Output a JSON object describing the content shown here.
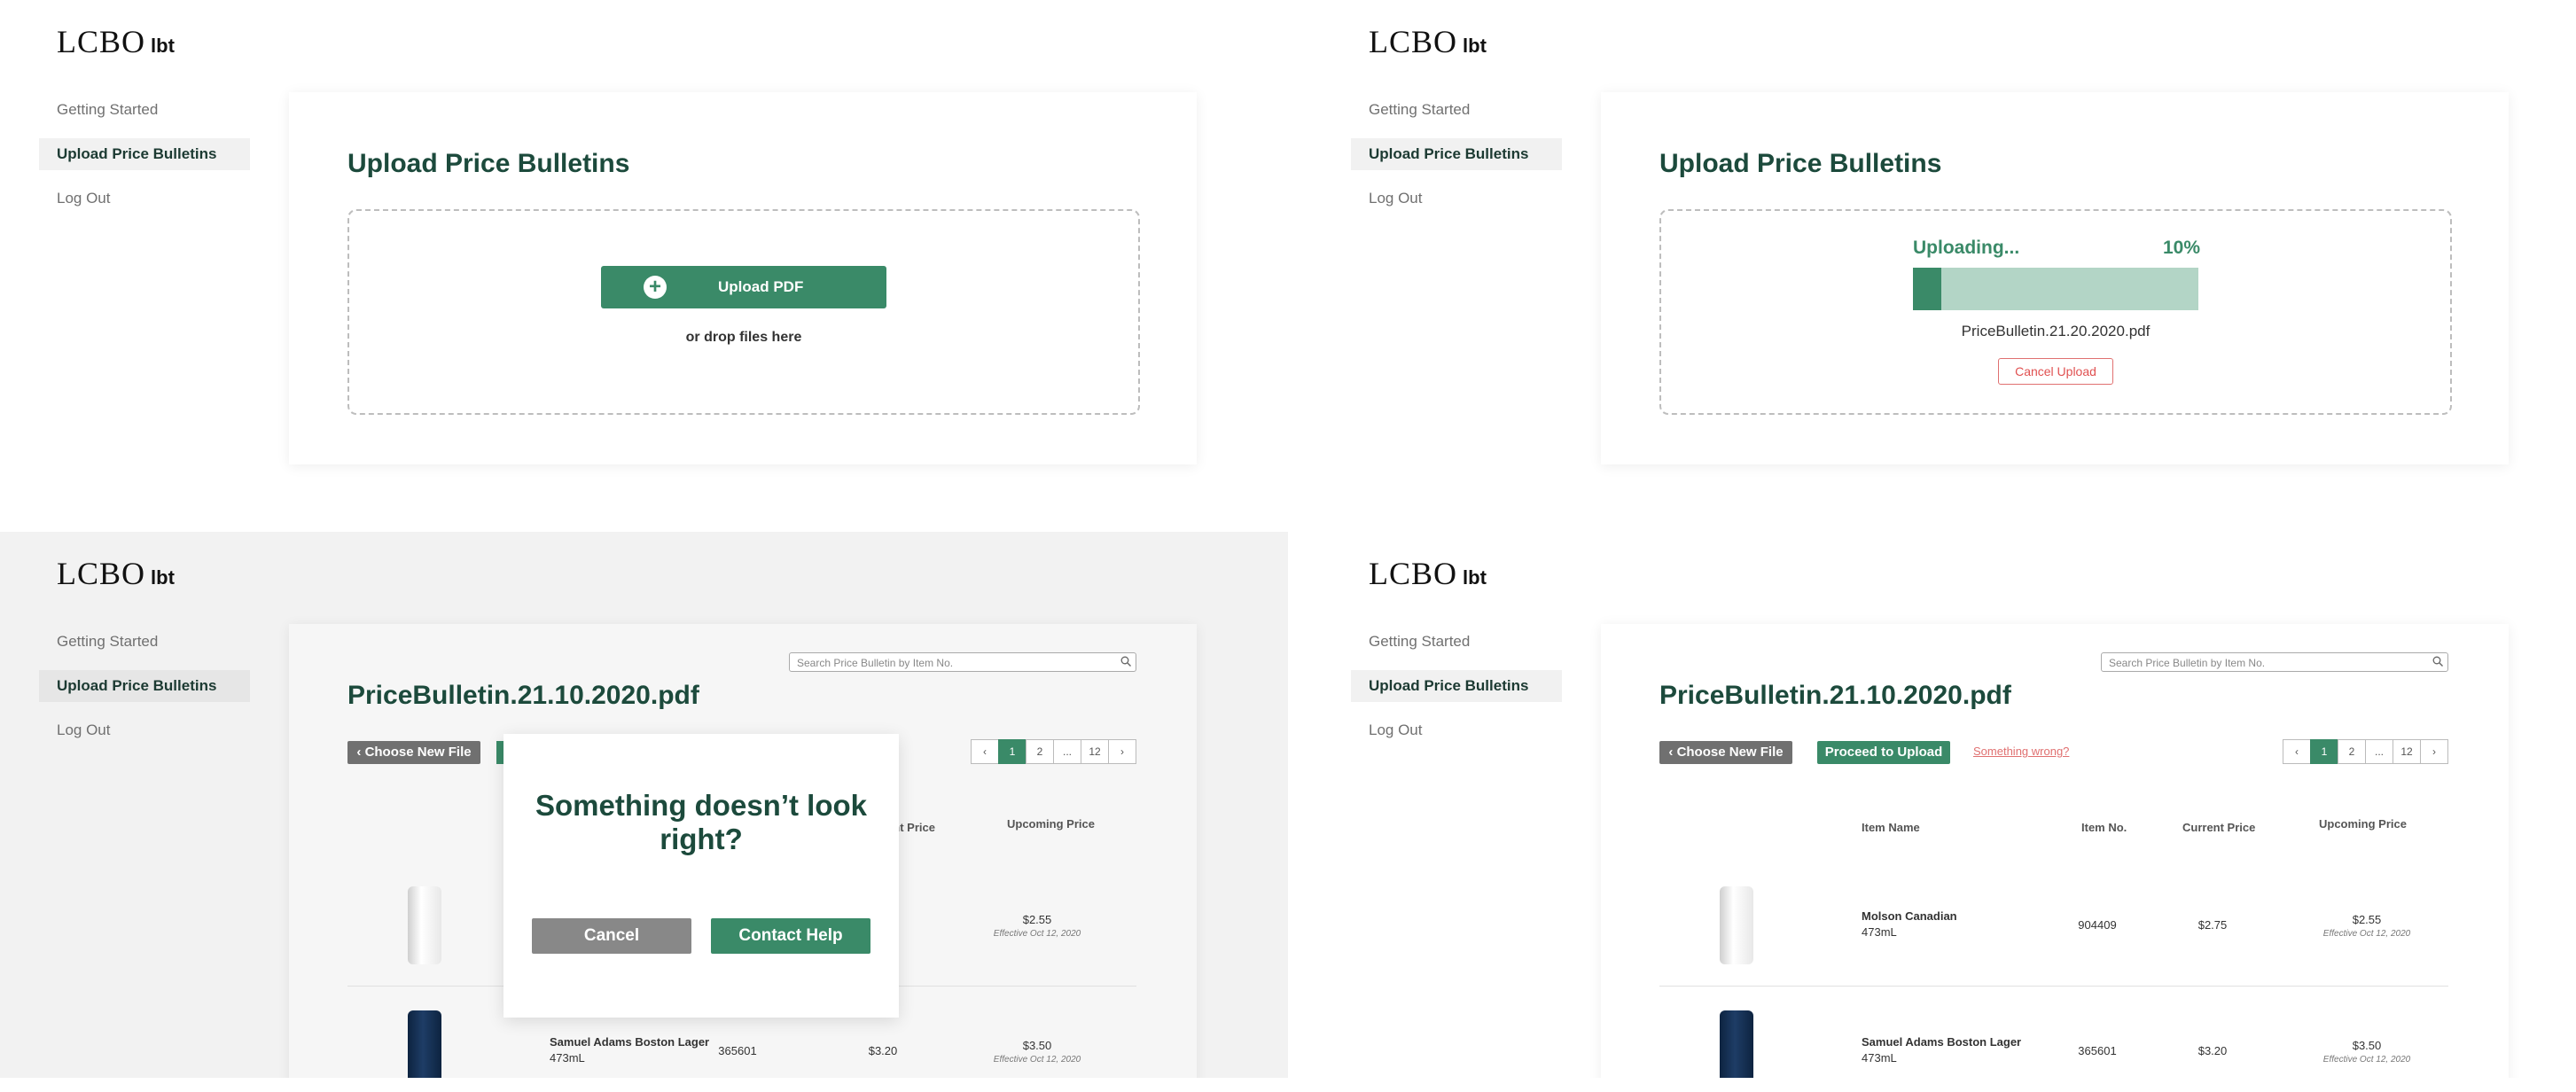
{
  "logo": {
    "main": "LCBO",
    "sub": "lbt"
  },
  "nav": [
    "Getting Started",
    "Upload Price Bulletins",
    "Log Out"
  ],
  "upload": {
    "title": "Upload Price Bulletins",
    "button": "Upload PDF",
    "button_icon": "plus-circle-icon",
    "hint": "or drop files here"
  },
  "uploading": {
    "label": "Uploading...",
    "percent_text": "10%",
    "progress": 0.1,
    "file": "PriceBulletin.21.20.2020.pdf",
    "cancel": "Cancel Upload"
  },
  "review": {
    "title": "PriceBulletin.21.10.2020.pdf",
    "search_placeholder": "Search Price Bulletin by Item No.",
    "choose_new": "Choose New File",
    "proceed": "Proceed to Upload",
    "something_wrong": "Something wrong?",
    "pages": [
      "1",
      "2",
      "...",
      "12"
    ],
    "columns": {
      "name": "Item Name",
      "item_no": "Item No.",
      "current": "Current Price",
      "upcoming": "Upcoming Price"
    },
    "columns_partial": {
      "current": "urrent Price"
    },
    "rows": [
      {
        "name": "Molson Canadian",
        "size": "473mL",
        "item_no": "904409",
        "current": "$2.75",
        "upcoming": "$2.55",
        "effective": "Effective Oct 12, 2020"
      },
      {
        "name": "Samuel Adams Boston Lager",
        "size": "473mL",
        "item_no": "365601",
        "current": "$3.20",
        "upcoming": "$3.50",
        "effective": "Effective Oct 12, 2020"
      }
    ]
  },
  "modal": {
    "title": "Something doesn’t look right?",
    "cancel": "Cancel",
    "help": "Contact Help"
  },
  "colors": {
    "accent": "#3a8a68",
    "heading": "#1c4a3c",
    "danger": "#e05050"
  }
}
